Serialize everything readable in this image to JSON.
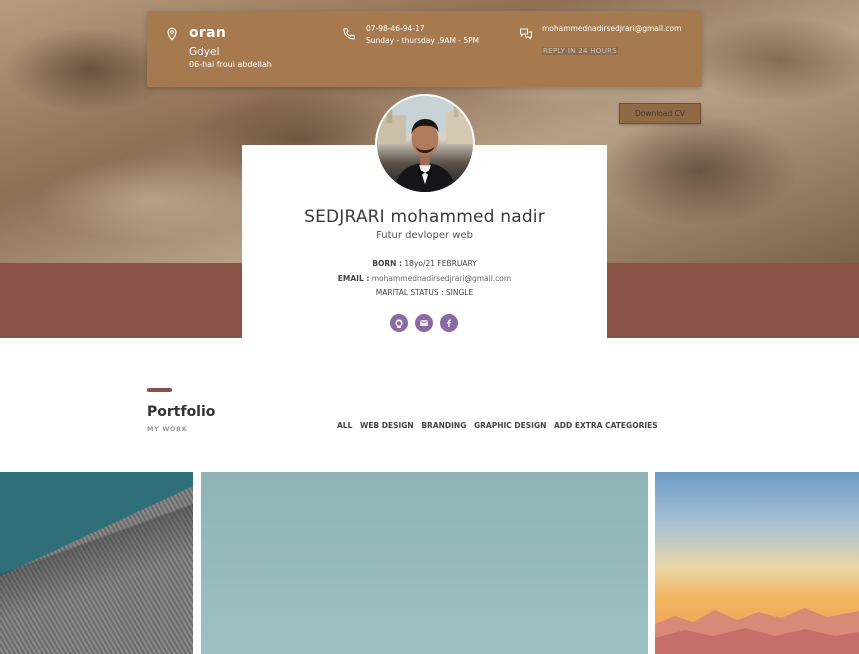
{
  "contact": {
    "city": "oran",
    "town": "Gdyel",
    "address": "06-hai froui abdellah",
    "phone": "07-98-46-94-17",
    "hours": "Sunday - thursday ,9AM - 5PM",
    "email": "mohammednadirsedjrari@gmail.com",
    "reply_note": "REPLY IN 24 HOURS",
    "icons": [
      "map-pin-icon",
      "phone-icon",
      "chat-icon"
    ]
  },
  "download_cv": "Download CV",
  "profile": {
    "name": "SEDJRARI mohammed nadir",
    "role": "Futur devloper web",
    "born_label": "BORN :",
    "born_value": " 18yo/21 FEBRUARY",
    "email_label": "EMAIL :",
    "email_value": " mohammednadirsedjrari@gmail.com",
    "marital_label": "MARITAL STATUS :",
    "marital_value": " SINGLE",
    "socials": [
      "github-icon",
      "mail-icon",
      "facebook-icon"
    ]
  },
  "portfolio": {
    "title": "Portfolio",
    "subtitle": "MY WORK",
    "filters": [
      "ALL",
      "WEB DESIGN",
      "BRANDING",
      "GRAPHIC DESIGN",
      "ADD EXTRA CATEGORIES"
    ]
  },
  "colors": {
    "accent_brown": "#8b5347",
    "contact_bar": "#a67a4e",
    "social_purple": "#8a6aa0"
  }
}
